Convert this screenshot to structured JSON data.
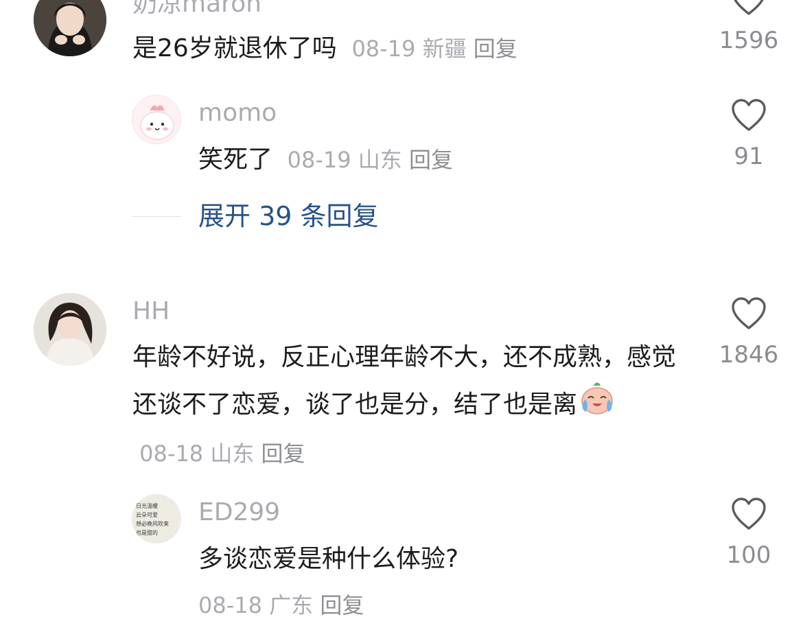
{
  "comments": [
    {
      "username": "奶凉maron",
      "text": "是26岁就退休了吗",
      "date": "08-19",
      "location": "新疆",
      "reply_label": "回复",
      "likes": "1596"
    },
    {
      "username": "HH",
      "text": "年龄不好说，反正心理年龄不大，还不成熟，感觉还谈不了恋爱，谈了也是分，结了也是离",
      "date": "08-18",
      "location": "山东",
      "reply_label": "回复",
      "likes": "1846"
    }
  ],
  "replies": [
    {
      "username": "momo",
      "text": "笑死了",
      "date": "08-19",
      "location": "山东",
      "reply_label": "回复",
      "likes": "91"
    },
    {
      "username": "ED299",
      "text": "多谈恋爱是种什么体验?",
      "date": "08-18",
      "location": "广东",
      "reply_label": "回复",
      "likes": "100",
      "avatar_text": "日光温暖 云朵可爱 想必晚风吹来 也是甜的"
    }
  ],
  "expand_replies": "展开 39 条回复",
  "colors": {
    "name": "#a9abb0",
    "text": "#1c1c1e",
    "link": "#27528a"
  }
}
